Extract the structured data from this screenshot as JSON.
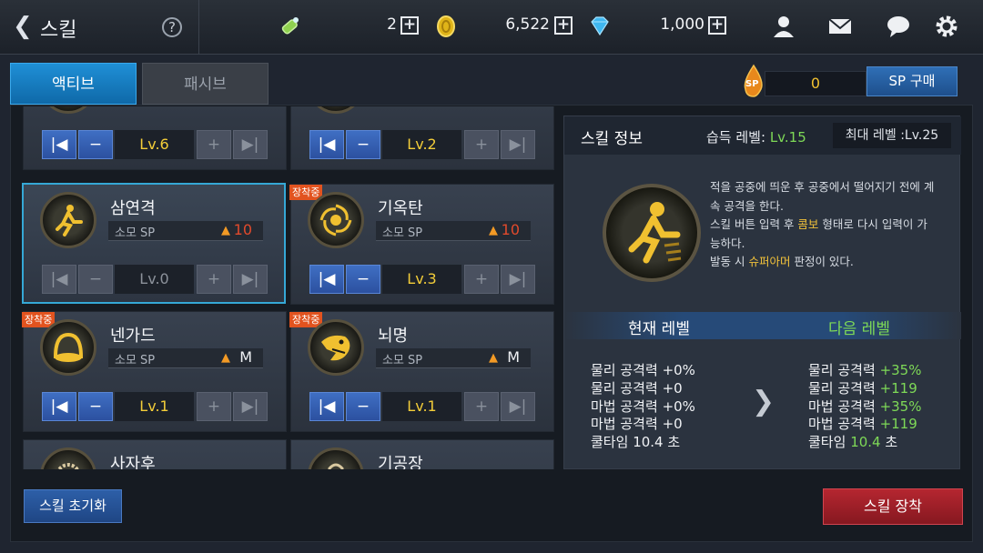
{
  "header": {
    "back_icon": "chevron-left-icon",
    "title": "스킬",
    "help_label": "?",
    "resources": [
      {
        "icon": "potion-icon",
        "value": "2"
      },
      {
        "icon": "gold-coin-icon",
        "value": "6,522"
      },
      {
        "icon": "diamond-icon",
        "value": "1,000"
      }
    ],
    "actions": [
      "friends-icon",
      "mail-icon",
      "chat-icon",
      "settings-icon"
    ]
  },
  "tabs": {
    "active": "액티브",
    "inactive": "패시브"
  },
  "sp": {
    "value": "0",
    "buy_label": "SP 구매",
    "icon": "sp-flame-icon",
    "drop_label": "SP"
  },
  "skills": [
    {
      "name": "",
      "sp": "",
      "level": "Lv.6",
      "equipped": false
    },
    {
      "name": "",
      "sp": "",
      "level": "Lv.2",
      "equipped": false
    },
    {
      "name": "삼연격",
      "sp_label": "소모 SP",
      "sp": "10",
      "level": "Lv.0",
      "equipped": false,
      "selected": true
    },
    {
      "name": "기옥탄",
      "sp_label": "소모 SP",
      "sp": "10",
      "level": "Lv.3",
      "equipped": true
    },
    {
      "name": "넨가드",
      "sp_label": "소모 SP",
      "sp": "M",
      "level": "Lv.1",
      "equipped": true
    },
    {
      "name": "뇌명",
      "sp_label": "소모 SP",
      "sp": "M",
      "level": "Lv.1",
      "equipped": true
    },
    {
      "name": "사자후",
      "equipped": false
    },
    {
      "name": "기공장",
      "equipped": false
    }
  ],
  "equip_badge": "장착중",
  "info": {
    "title": "스킬 정보",
    "learn_label": "습득 레벨:",
    "learn_value": "Lv.15",
    "max_level": "최대 레벨 :Lv.25",
    "desc": {
      "l1": "적을 공중에 띄운 후 공중에서 떨어지기 전에 계",
      "l2": "속 공격을 한다.",
      "l3a": "스킬 버튼 입력 후 ",
      "l3b": "콤보",
      "l3c": " 형태로 다시 입력이 가",
      "l4": "능하다.",
      "l5a": "발동 시 ",
      "l5b": "슈퍼아머",
      "l5c": " 판정이 있다."
    },
    "current_label": "현재 레벨",
    "next_label": "다음 레벨",
    "current_stats": [
      {
        "label": "물리 공격력",
        "value": "+0%"
      },
      {
        "label": "물리 공격력",
        "value": "+0"
      },
      {
        "label": "마법 공격력",
        "value": "+0%"
      },
      {
        "label": "마법 공격력",
        "value": "+0"
      },
      {
        "label": "쿨타임",
        "value": "10.4 초"
      }
    ],
    "next_stats": [
      {
        "label": "물리 공격력",
        "value": "+35%"
      },
      {
        "label": "물리 공격력",
        "value": "+119"
      },
      {
        "label": "마법 공격력",
        "value": "+35%"
      },
      {
        "label": "마법 공격력",
        "value": "+119"
      },
      {
        "label": "쿨타임",
        "value": "10.4",
        "suffix": "초"
      }
    ]
  },
  "footer": {
    "reset_label": "스킬 초기화",
    "equip_label": "스킬 장착"
  }
}
